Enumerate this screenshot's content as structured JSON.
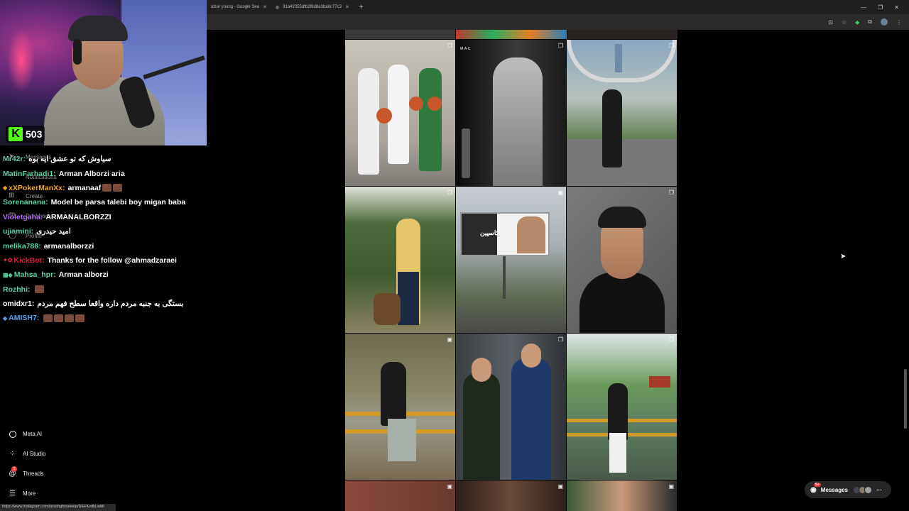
{
  "browser": {
    "tabs": [
      {
        "label": "olzar young - Google Sea"
      },
      {
        "label": "31a42055dfb2f6d8e3ba6c77c3"
      }
    ],
    "new_tab_icon": "plus-icon",
    "window_controls": [
      "minimize-icon",
      "restore-icon",
      "close-icon"
    ]
  },
  "stream": {
    "platform": "kick",
    "viewer_count": "503",
    "accent": "#53fc18"
  },
  "chat": [
    {
      "badge": "",
      "user": "Mr42r:",
      "user_color": "#5ad1a0",
      "message": "سیاوش که تو عشق ایه بوه"
    },
    {
      "badge": "",
      "user": "MatinFarhadi1:",
      "user_color": "#5ad1a0",
      "message": "Arman Alborzi aria"
    },
    {
      "badge": "◈",
      "user": "xXPokerManXx:",
      "user_color": "#f5a623",
      "message": "armanaaf"
    },
    {
      "badge": "",
      "user": "Sorenanana:",
      "user_color": "#5ad1a0",
      "message": "Model be parsa talebi boy migan baba"
    },
    {
      "badge": "",
      "user": "Violetgaha:",
      "user_color": "#b06cf0",
      "message": "ARMANALBORZZI"
    },
    {
      "badge": "",
      "user": "ujiamini:",
      "user_color": "#5ad1a0",
      "message": "امید حیدری"
    },
    {
      "badge": "",
      "user": "melika788:",
      "user_color": "#5ad1a0",
      "message": "armanalborzzi"
    },
    {
      "badge": "✦✿",
      "user": "KickBot:",
      "user_color": "#e01e37",
      "message": "Thanks for the follow @ahmadzaraei"
    },
    {
      "badge": "▦◈",
      "user": "Mahsa_hpr:",
      "user_color": "#5ad1a0",
      "message": "Arman alborzi"
    },
    {
      "badge": "",
      "user": "Rozhhi:",
      "user_color": "#5ad1a0",
      "message": ""
    },
    {
      "badge": "",
      "user": "omidxr1:",
      "user_color": "#ffffff",
      "message": "بستگی به جنبه مردم داره واقعا سطح فهم مردم"
    },
    {
      "badge": "◈",
      "user": "AMISH7:",
      "user_color": "#4aa3f0",
      "message": ""
    }
  ],
  "sidebar_ghost": [
    {
      "label": "Messages",
      "icon": "send-icon"
    },
    {
      "label": "Notifications",
      "icon": "heart-icon"
    },
    {
      "label": "Create",
      "icon": "plus-square-icon"
    },
    {
      "label": "Dashboard",
      "icon": "chart-icon"
    },
    {
      "label": "Profile",
      "icon": "profile-icon"
    }
  ],
  "sidebar": [
    {
      "label": "Meta AI",
      "icon": "meta-ai-icon"
    },
    {
      "label": "AI Studio",
      "icon": "ai-studio-icon"
    },
    {
      "label": "Threads",
      "icon": "threads-icon",
      "badge": "3"
    },
    {
      "label": "More",
      "icon": "menu-icon"
    }
  ],
  "status_url": "https://www.instagram.com/arashghoseini/p/DEFKvdkLwM/",
  "grid": {
    "billboard_text": "کاسپین",
    "tiles": [
      {
        "name": "post-basketball-trio",
        "type": "carousel"
      },
      {
        "name": "post-bw-portrait",
        "type": "carousel"
      },
      {
        "name": "post-museum-future",
        "type": "carousel"
      },
      {
        "name": "post-dog-walk",
        "type": "carousel"
      },
      {
        "name": "post-billboard",
        "type": "reel"
      },
      {
        "name": "post-studio-portrait",
        "type": "carousel"
      },
      {
        "name": "post-fence-sitting",
        "type": "reel"
      },
      {
        "name": "post-suits",
        "type": "carousel"
      },
      {
        "name": "post-lake",
        "type": "carousel"
      }
    ]
  },
  "messages_pill": {
    "label": "Messages",
    "badge": "9+"
  }
}
